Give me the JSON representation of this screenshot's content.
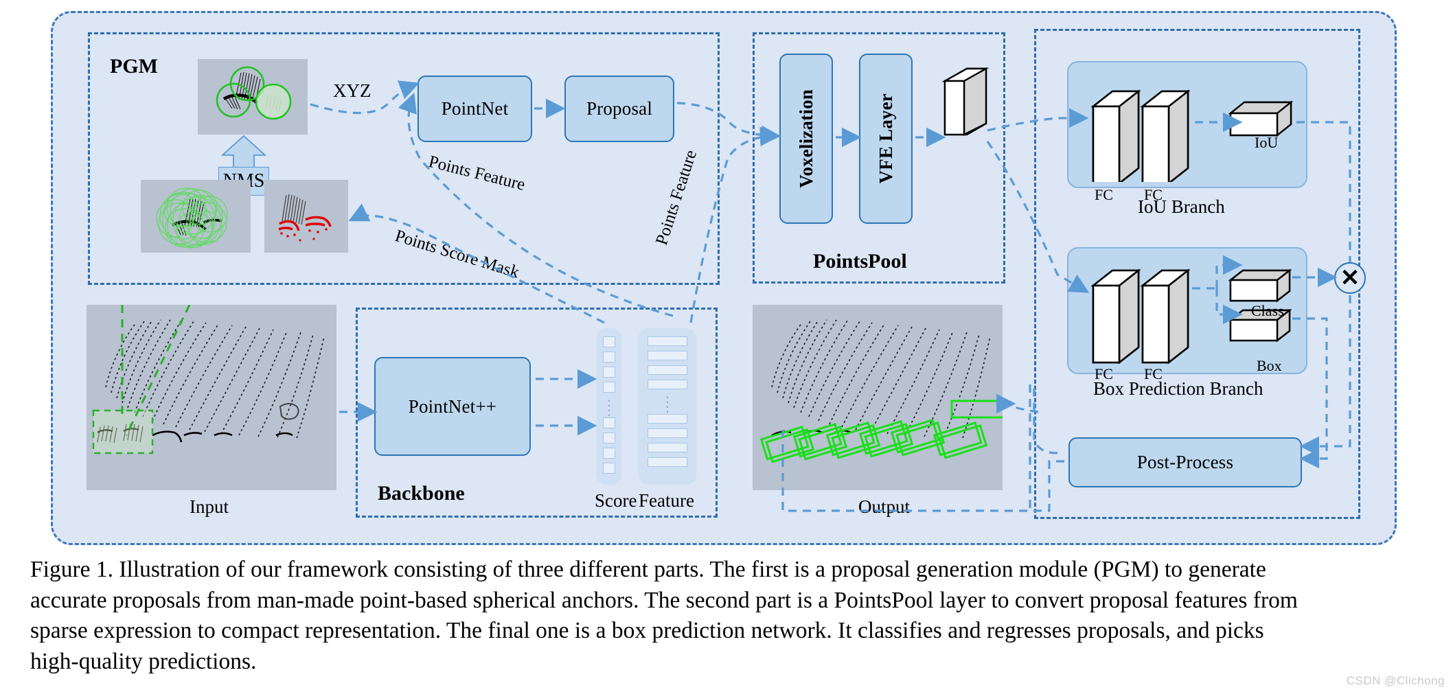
{
  "figure": {
    "modules": {
      "pgm": {
        "label": "PGM"
      },
      "backbone": {
        "label": "Backbone"
      },
      "pointspool": {
        "label": "PointsPool"
      }
    },
    "boxes": {
      "pointnet": "PointNet",
      "proposal": "Proposal",
      "pointnetpp": "PointNet++",
      "voxelization": "Voxelization",
      "vfe_layer": "VFE Layer",
      "post_process": "Post-Process",
      "nms": "NMS"
    },
    "branches": {
      "iou": {
        "title": "IoU Branch",
        "fc1": "FC",
        "fc2": "FC",
        "output": "IoU"
      },
      "box_prediction": {
        "title": "Box Prediction Branch",
        "fc1": "FC",
        "fc2": "FC",
        "output_class": "Class",
        "output_box": "Box"
      }
    },
    "flow_labels": {
      "xyz": "XYZ",
      "points_feature_1": "Points Feature",
      "points_score_mask": "Points Score Mask",
      "points_feature_2": "Points Feature"
    },
    "vectors": {
      "score_label": "Score",
      "feature_label": "Feature"
    },
    "thumbnails": {
      "input": "Input",
      "output": "Output"
    },
    "operators": {
      "multiply": "✕"
    },
    "colors": {
      "outer_background": "#dce6f4",
      "dashed_border": "#3b76b8",
      "box_fill": "#bdd7ee",
      "box_stroke": "#2e75b6",
      "arrow": "#5b9bd5",
      "pointcloud_background": "#b9c2d0",
      "anchor_green": "#22c322",
      "mask_red": "#e00000",
      "detection_green": "#18e018"
    }
  },
  "caption": {
    "lines": [
      "Figure 1. Illustration of our framework consisting of three different parts.  The first is a proposal generation module (PGM) to generate",
      "accurate proposals from man-made point-based spherical anchors. The second part is a PointsPool layer to convert proposal features from",
      "sparse expression to compact representation.  The final one is a box prediction network.  It classifies and regresses proposals, and picks",
      "high-quality predictions."
    ]
  },
  "watermark": {
    "text": "CSDN @Clichong"
  }
}
